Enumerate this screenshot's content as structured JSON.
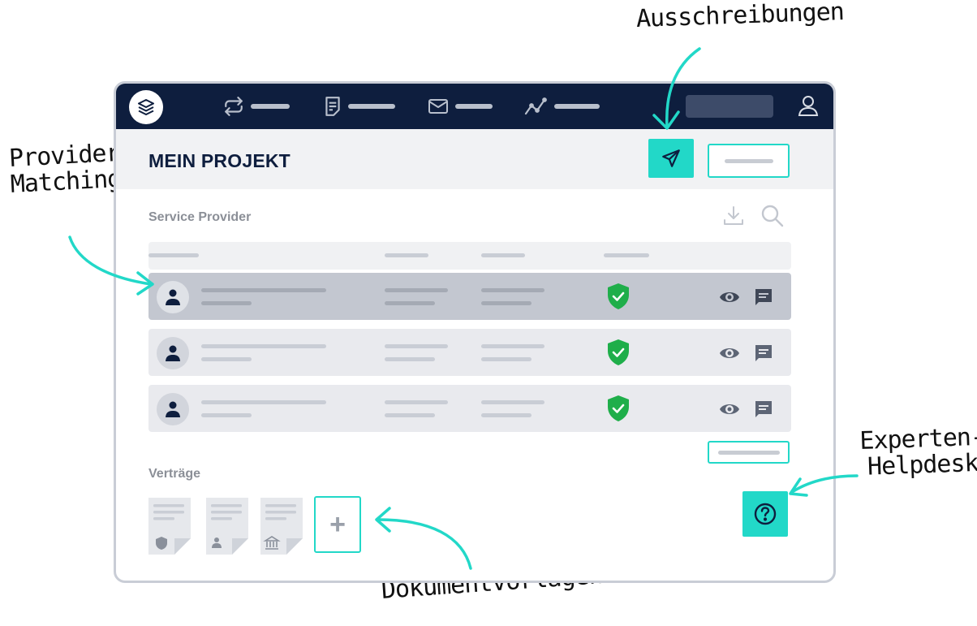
{
  "annotations": {
    "ausschreibungen": "Ausschreibungen",
    "provider_line1": "Provider-",
    "provider_line2": "Matching",
    "experten_line1": "Experten-",
    "experten_line2": "Helpdesk",
    "dokumentvorlagen": "Dokumentvorlagen"
  },
  "header": {
    "title": "MEIN PROJEKT"
  },
  "sections": {
    "service_provider": "Service Provider",
    "vertraege": "Verträge"
  },
  "add_document_label": "+",
  "colors": {
    "accent": "#22d8c8",
    "navbar": "#0e1e3e",
    "verified": "#1fae4a"
  },
  "icons": {
    "logo": "layers-icon",
    "nav": [
      "exchange-icon",
      "document-icon",
      "mail-icon",
      "analytics-icon"
    ],
    "user": "user-icon",
    "send": "paper-plane-icon",
    "download": "download-icon",
    "search": "search-icon",
    "row_actions": [
      "eye-icon",
      "chat-icon"
    ],
    "verified": "shield-check-icon",
    "help": "help-icon",
    "doc_badges": [
      "shield-icon",
      "person-icon",
      "bank-icon"
    ]
  },
  "providers": [
    {
      "verified": true,
      "selected": true
    },
    {
      "verified": true,
      "selected": false
    },
    {
      "verified": true,
      "selected": false
    }
  ]
}
